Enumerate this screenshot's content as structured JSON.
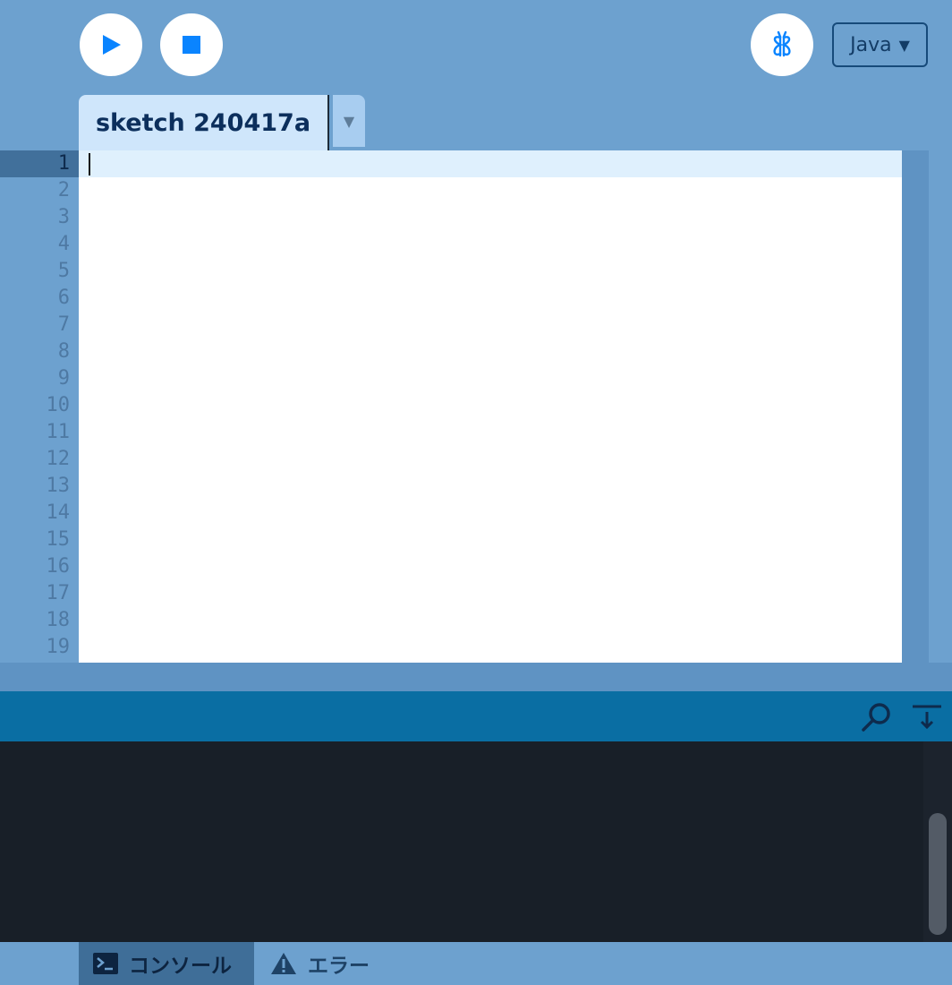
{
  "toolbar": {
    "run_icon": "play-icon",
    "stop_icon": "stop-icon",
    "debug_icon": "debugger-butterfly-icon",
    "mode": "Java",
    "mode_arrow": "▼"
  },
  "tabs": [
    {
      "label": "sketch 240417a",
      "menu_arrow": "▼"
    }
  ],
  "editor": {
    "line_numbers": [
      "1",
      "2",
      "3",
      "4",
      "5",
      "6",
      "7",
      "8",
      "9",
      "10",
      "11",
      "12",
      "13",
      "14",
      "15",
      "16",
      "17",
      "18",
      "19"
    ],
    "active_line": "1"
  },
  "console": {
    "search_icon": "search-icon",
    "scroll_lock_icon": "scroll-down-icon"
  },
  "status_tabs": {
    "console_label": "コンソール",
    "console_icon": "terminal-icon",
    "errors_label": "エラー",
    "errors_icon": "warning-icon"
  },
  "colors": {
    "accent": "#0a84ff",
    "background": "#6da1cf",
    "console_header": "#0a6ea3",
    "console_body": "#181f28"
  }
}
